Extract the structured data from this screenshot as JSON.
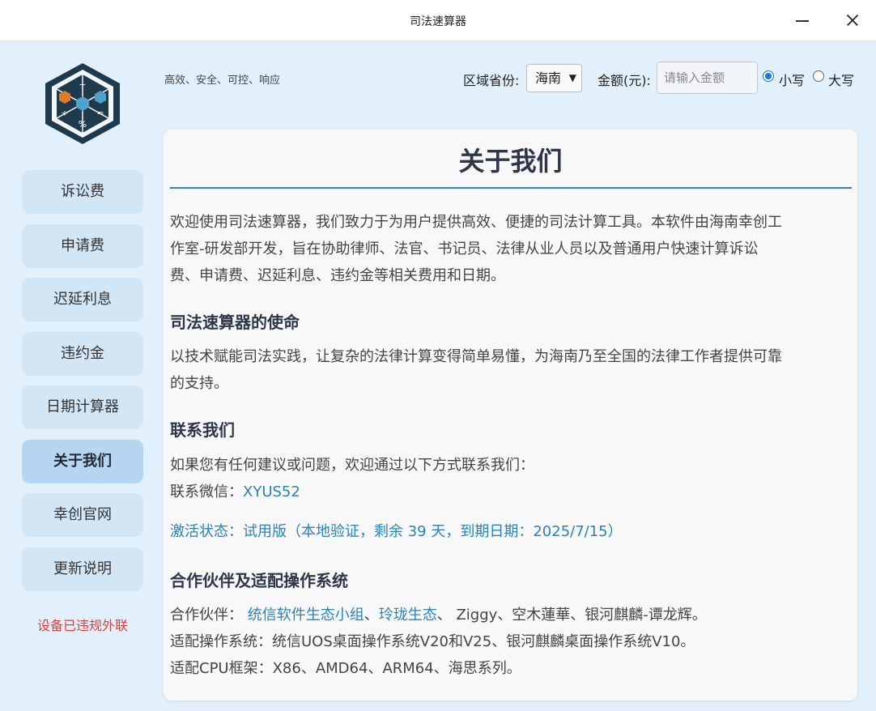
{
  "window": {
    "title": "司法速算器"
  },
  "sidebar": {
    "items": [
      {
        "label": "诉讼费"
      },
      {
        "label": "申请费"
      },
      {
        "label": "迟延利息"
      },
      {
        "label": "违约金"
      },
      {
        "label": "日期计算器"
      },
      {
        "label": "关于我们",
        "active": true
      },
      {
        "label": "幸创官网"
      },
      {
        "label": "更新说明"
      }
    ],
    "warning": "设备已违规外联"
  },
  "topbar": {
    "slogan": "高效、安全、可控、响应",
    "region_label": "区域省份:",
    "region_value": "海南",
    "amount_label": "金额(元):",
    "amount_placeholder": "请输入金额",
    "amount_value": "",
    "case_options": [
      {
        "label": "小写",
        "checked": true
      },
      {
        "label": "大写",
        "checked": false
      }
    ]
  },
  "about": {
    "title": "关于我们",
    "intro_lines": [
      "欢迎使用司法速算器，我们致力于为用户提供高效、便捷的司法计算工具。本软件由海南幸创工",
      "作室-研发部开发，旨在协助律师、法官、书记员、法律从业人员以及普通用户快速计算诉讼",
      "费、申请费、迟延利息、违约金等相关费用和日期。"
    ],
    "mission_heading": "司法速算器的使命",
    "mission_lines": [
      "以技术赋能司法实践，让复杂的法律计算变得简单易懂，为海南乃至全国的法律工作者提供可靠",
      "的支持。"
    ],
    "contact_heading": "联系我们",
    "contact_intro": "如果您有任何建议或问题，欢迎通过以下方式联系我们：",
    "wechat_label": "联系微信：",
    "wechat_value": "XYUS52",
    "activation_status": "激活状态：试用版（本地验证，剩余 39 天，到期日期：2025/7/15）",
    "partners_heading": "合作伙伴及适配操作系统",
    "partners_label": "合作伙伴：",
    "partner_link_1": "统信软件生态小组",
    "partner_sep_1": "、",
    "partner_link_2": "玲珑生态",
    "partners_rest": "、 Ziggy、空木蓮華、银河麒麟-谭龙辉。",
    "os_line": "适配操作系统：统信UOS桌面操作系统V20和V25、银河麒麟桌面操作系统V10。",
    "cpu_line": "适配CPU框架：X86、AMD64、ARM64、海思系列。"
  },
  "colors": {
    "app_background": "#e1f0fb",
    "nav_item": "#d3e6f6",
    "nav_item_active": "#b6d5f0",
    "accent": "#3182ce",
    "link": "#2b82c0",
    "warning": "#e53e3e",
    "logo_dark": "#1e3a4c"
  }
}
